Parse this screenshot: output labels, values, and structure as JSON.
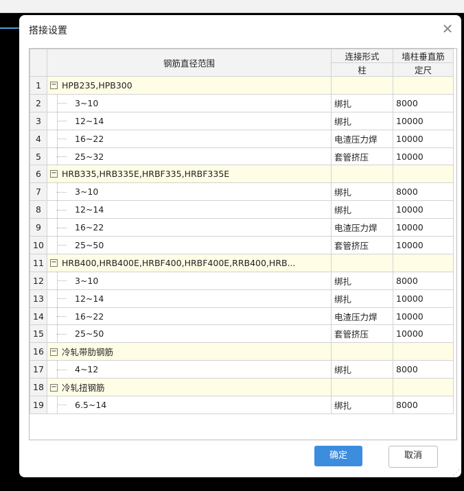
{
  "dialog": {
    "title": "搭接设置",
    "close_symbol": "✕",
    "ok_label": "确定",
    "cancel_label": "取消"
  },
  "table": {
    "headers": {
      "range": "钢筋直径范围",
      "connection_top": "连接形式",
      "connection_bottom": "柱",
      "length_top": "墙柱垂直筋",
      "length_bottom": "定尺"
    },
    "rows": [
      {
        "no": "1",
        "type": "group",
        "name": "HPB235,HPB300",
        "connection": "",
        "length": ""
      },
      {
        "no": "2",
        "type": "child",
        "name": "3~10",
        "connection": "绑扎",
        "length": "8000"
      },
      {
        "no": "3",
        "type": "child",
        "name": "12~14",
        "connection": "绑扎",
        "length": "10000"
      },
      {
        "no": "4",
        "type": "child",
        "name": "16~22",
        "connection": "电渣压力焊",
        "length": "10000"
      },
      {
        "no": "5",
        "type": "child",
        "name": "25~32",
        "connection": "套管挤压",
        "length": "10000"
      },
      {
        "no": "6",
        "type": "group",
        "name": "HRB335,HRB335E,HRBF335,HRBF335E",
        "connection": "",
        "length": ""
      },
      {
        "no": "7",
        "type": "child",
        "name": "3~10",
        "connection": "绑扎",
        "length": "8000"
      },
      {
        "no": "8",
        "type": "child",
        "name": "12~14",
        "connection": "绑扎",
        "length": "10000"
      },
      {
        "no": "9",
        "type": "child",
        "name": "16~22",
        "connection": "电渣压力焊",
        "length": "10000"
      },
      {
        "no": "10",
        "type": "child",
        "name": "25~50",
        "connection": "套管挤压",
        "length": "10000"
      },
      {
        "no": "11",
        "type": "group",
        "name": "HRB400,HRB400E,HRBF400,HRBF400E,RRB400,HRB...",
        "connection": "",
        "length": ""
      },
      {
        "no": "12",
        "type": "child",
        "name": "3~10",
        "connection": "绑扎",
        "length": "8000"
      },
      {
        "no": "13",
        "type": "child",
        "name": "12~14",
        "connection": "绑扎",
        "length": "10000"
      },
      {
        "no": "14",
        "type": "child",
        "name": "16~22",
        "connection": "电渣压力焊",
        "length": "10000"
      },
      {
        "no": "15",
        "type": "child",
        "name": "25~50",
        "connection": "套管挤压",
        "length": "10000"
      },
      {
        "no": "16",
        "type": "group",
        "name": "冷轧带肋钢筋",
        "connection": "",
        "length": ""
      },
      {
        "no": "17",
        "type": "child",
        "name": "4~12",
        "connection": "绑扎",
        "length": "8000"
      },
      {
        "no": "18",
        "type": "group",
        "name": "冷轧扭钢筋",
        "connection": "",
        "length": ""
      },
      {
        "no": "19",
        "type": "child",
        "name": "6.5~14",
        "connection": "绑扎",
        "length": "8000"
      }
    ]
  },
  "icons": {
    "collapse": "collapse-minus-icon",
    "close": "close-icon",
    "resize": "resize-grip-icon"
  }
}
